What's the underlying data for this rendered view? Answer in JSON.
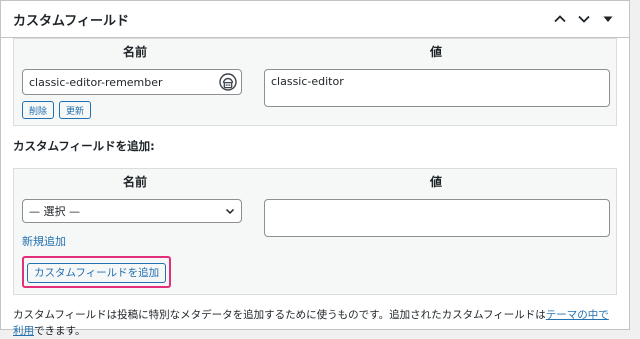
{
  "metabox": {
    "title": "カスタムフィールド",
    "move_up_icon": "chevron-up-icon",
    "move_down_icon": "chevron-down-icon",
    "toggle_icon": "triangle-down-icon"
  },
  "existing": {
    "headers": {
      "name": "名前",
      "value": "値"
    },
    "key_value": "classic-editor-remember",
    "value_text": "classic-editor",
    "delete_label": "削除",
    "update_label": "更新"
  },
  "add_new": {
    "heading": "カスタムフィールドを追加:",
    "headers": {
      "name": "名前",
      "value": "値"
    },
    "select_value": "— 選択 —",
    "new_link": "新規追加",
    "add_button": "カスタムフィールドを追加"
  },
  "description": {
    "text_before": "カスタムフィールドは投稿に特別なメタデータを追加するために使うものです。追加されたカスタムフィールドは",
    "link_text": "テーマの中で利用",
    "text_after": "できます。"
  },
  "colors": {
    "accent": "#2271b1",
    "highlight": "#e32e7a",
    "border": "#c3c4c7"
  }
}
